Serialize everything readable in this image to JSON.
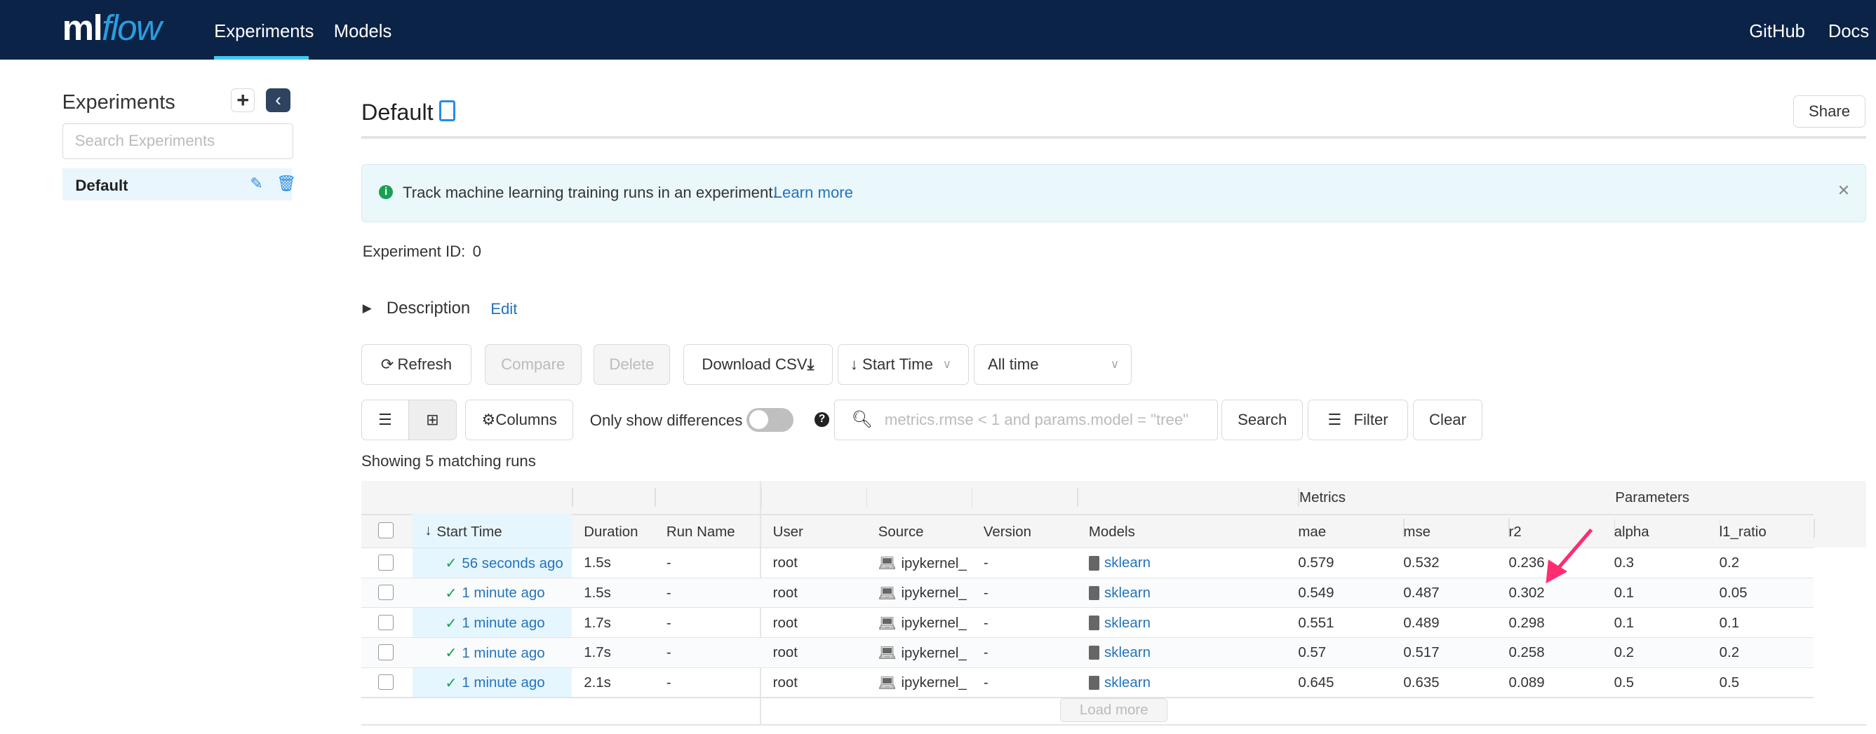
{
  "nav": {
    "logo": "mlflow",
    "tabs": [
      "Experiments",
      "Models"
    ],
    "active_tab": "Experiments",
    "right_links": [
      "GitHub",
      "Docs"
    ]
  },
  "sidebar": {
    "title": "Experiments",
    "search_placeholder": "Search Experiments",
    "items": [
      {
        "name": "Default",
        "selected": true
      }
    ]
  },
  "header": {
    "title": "Default",
    "share_label": "Share"
  },
  "alert": {
    "text": "Track machine learning training runs in an experiment.",
    "link": "Learn more"
  },
  "experiment_id": {
    "label": "Experiment ID:",
    "value": "0"
  },
  "description": {
    "label": "Description",
    "edit": "Edit"
  },
  "toolbar": {
    "refresh": "Refresh",
    "compare": "Compare",
    "delete": "Delete",
    "download": "Download CSV",
    "sort": "Start Time",
    "time_range": "All time",
    "columns": "Columns",
    "diff_toggle": "Only show differences",
    "diff_on": false,
    "search_placeholder": "metrics.rmse < 1 and params.model = \"tree\"",
    "search": "Search",
    "filter": "Filter",
    "clear": "Clear"
  },
  "summary": "Showing 5 matching runs",
  "table": {
    "groups": {
      "metrics": "Metrics",
      "parameters": "Parameters"
    },
    "columns": [
      "Start Time",
      "Duration",
      "Run Name",
      "User",
      "Source",
      "Version",
      "Models",
      "mae",
      "mse",
      "r2",
      "alpha",
      "l1_ratio"
    ],
    "rows": [
      {
        "start": "56 seconds ago",
        "duration": "1.5s",
        "run_name": "-",
        "user": "root",
        "source": "ipykernel_",
        "version": "-",
        "model": "sklearn",
        "mae": "0.579",
        "mse": "0.532",
        "r2": "0.236",
        "alpha": "0.3",
        "l1_ratio": "0.2"
      },
      {
        "start": "1 minute ago",
        "duration": "1.5s",
        "run_name": "-",
        "user": "root",
        "source": "ipykernel_",
        "version": "-",
        "model": "sklearn",
        "mae": "0.549",
        "mse": "0.487",
        "r2": "0.302",
        "alpha": "0.1",
        "l1_ratio": "0.05"
      },
      {
        "start": "1 minute ago",
        "duration": "1.7s",
        "run_name": "-",
        "user": "root",
        "source": "ipykernel_",
        "version": "-",
        "model": "sklearn",
        "mae": "0.551",
        "mse": "0.489",
        "r2": "0.298",
        "alpha": "0.1",
        "l1_ratio": "0.1"
      },
      {
        "start": "1 minute ago",
        "duration": "1.7s",
        "run_name": "-",
        "user": "root",
        "source": "ipykernel_",
        "version": "-",
        "model": "sklearn",
        "mae": "0.57",
        "mse": "0.517",
        "r2": "0.258",
        "alpha": "0.2",
        "l1_ratio": "0.2"
      },
      {
        "start": "1 minute ago",
        "duration": "2.1s",
        "run_name": "-",
        "user": "root",
        "source": "ipykernel_",
        "version": "-",
        "model": "sklearn",
        "mae": "0.645",
        "mse": "0.635",
        "r2": "0.089",
        "alpha": "0.5",
        "l1_ratio": "0.5"
      }
    ],
    "load_more": "Load more"
  },
  "colors": {
    "nav_bg": "#0b2346",
    "accent": "#43c9ed",
    "link": "#2374bb",
    "success": "#1aa053",
    "annotation_arrow": "#ff2d6f"
  }
}
